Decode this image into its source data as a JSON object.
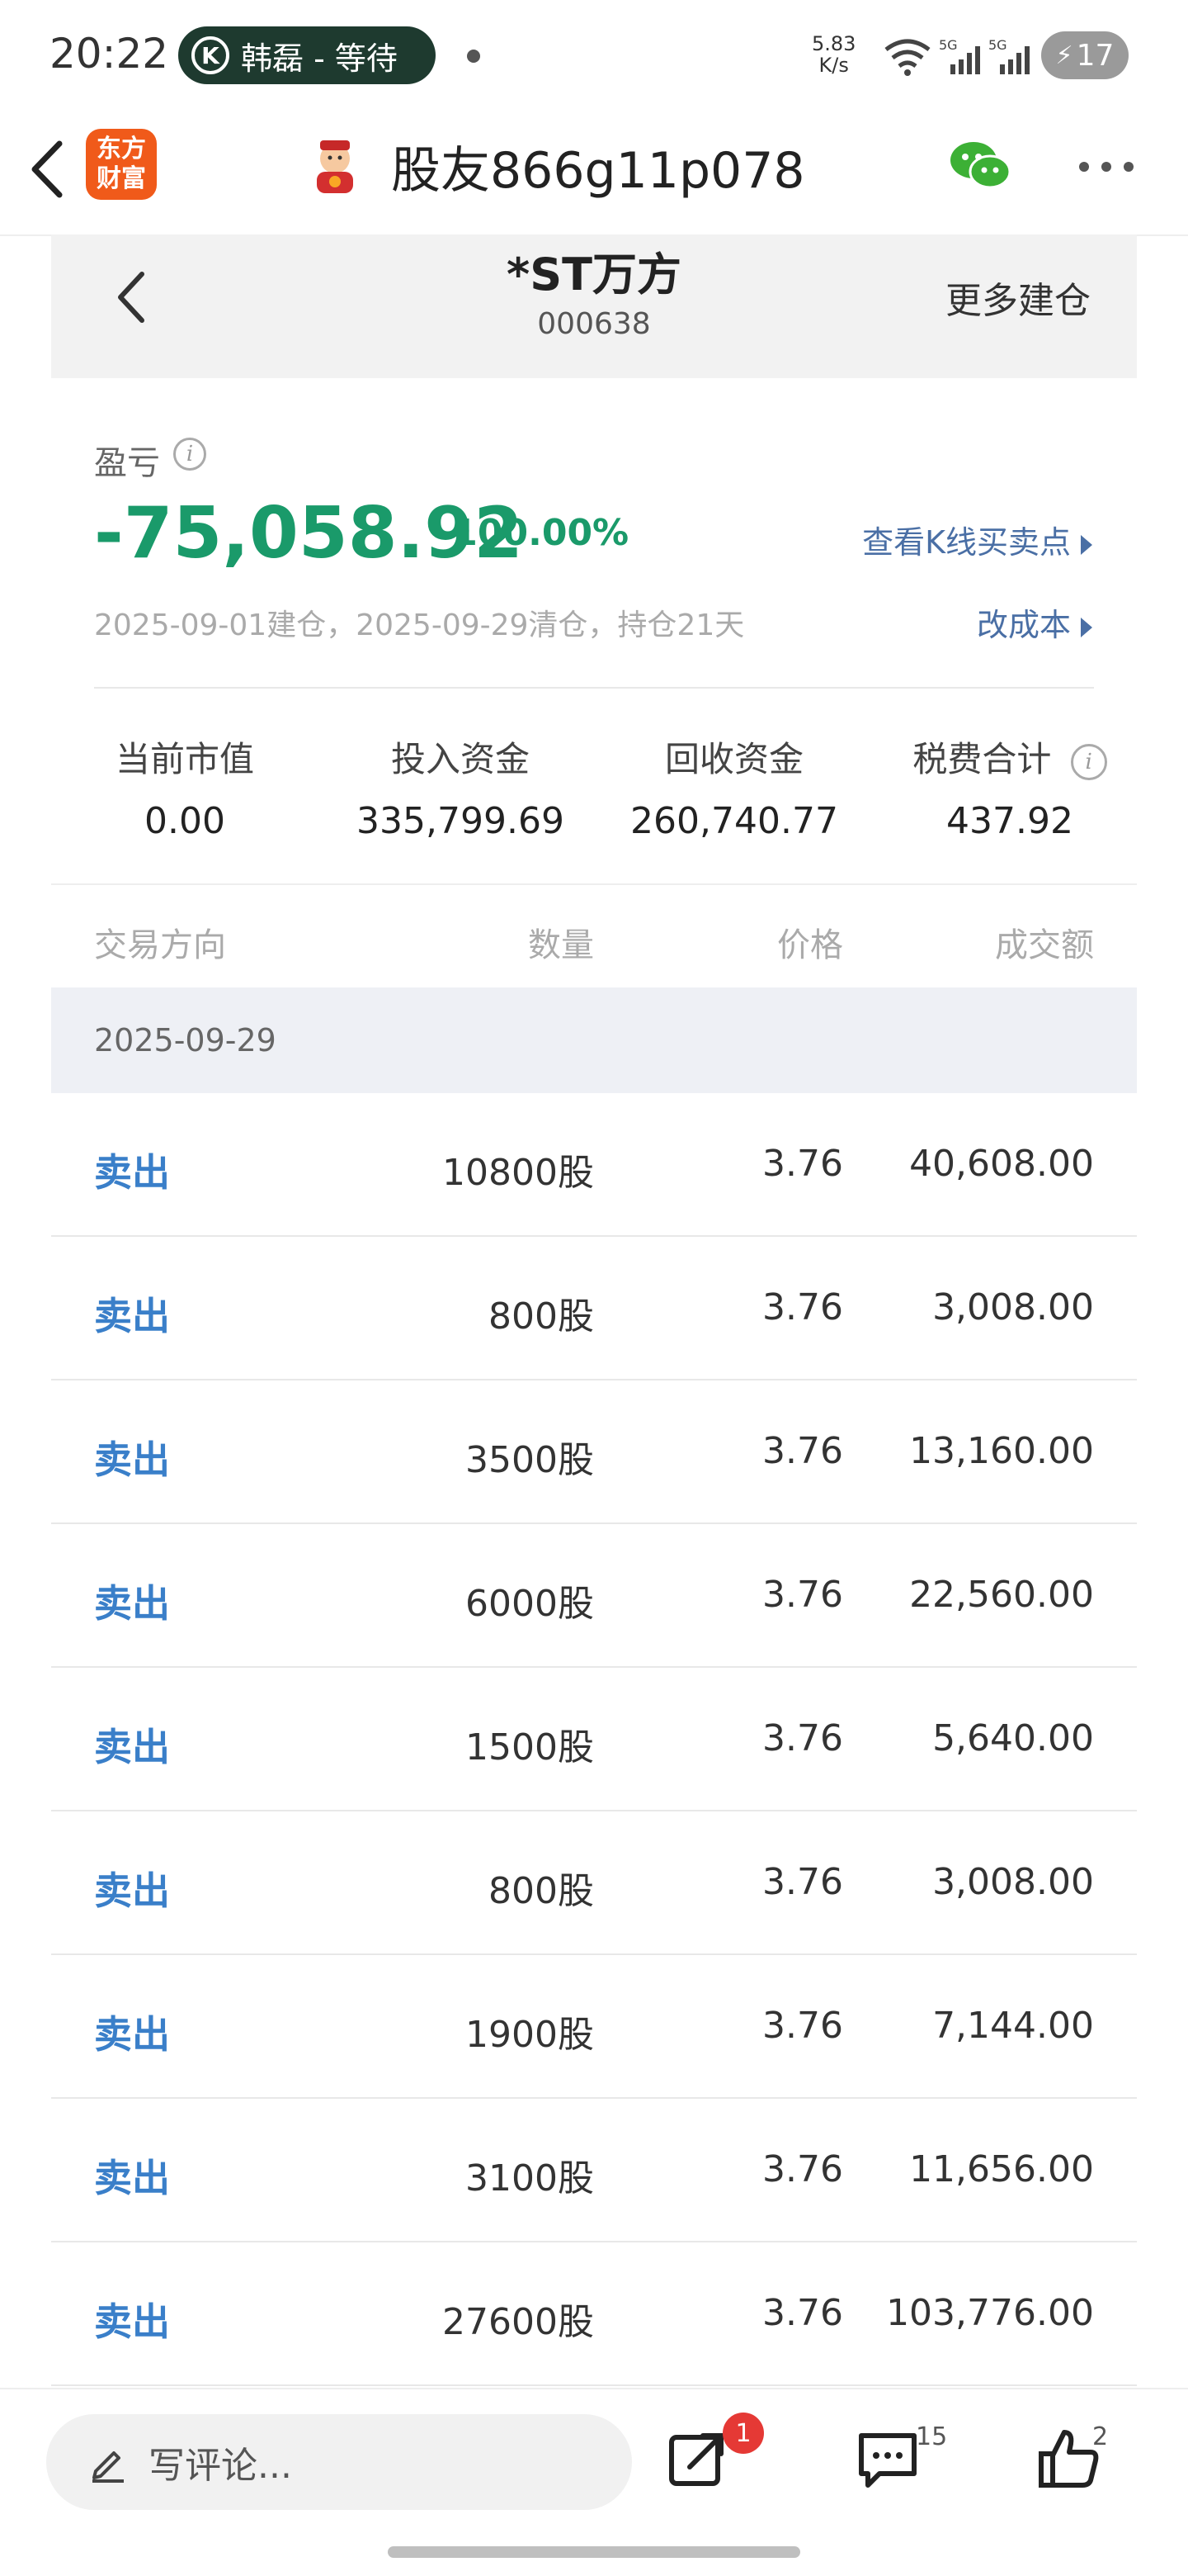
{
  "statusbar": {
    "time": "20:22",
    "pill_text": "韩磊 - 等待",
    "pill_icon": "K",
    "speed_value": "5.83",
    "speed_unit": "K/s",
    "battery": "17"
  },
  "nav": {
    "logo_text": "东方财富",
    "title": "股友866g11p078"
  },
  "stock": {
    "name": "*ST万方",
    "code": "000638",
    "more_action": "更多建仓"
  },
  "pl": {
    "label": "盈亏",
    "value": "-75,058.92",
    "percent": "-100.00%",
    "kline_link": "查看K线买卖点",
    "dates": "2025-09-01建仓，2025-09-29清仓，持仓21天",
    "cost_link": "改成本"
  },
  "stats": [
    {
      "label": "当前市值",
      "value": "0.00"
    },
    {
      "label": "投入资金",
      "value": "335,799.69"
    },
    {
      "label": "回收资金",
      "value": "260,740.77"
    },
    {
      "label": "税费合计",
      "value": "437.92"
    }
  ],
  "table": {
    "headers": {
      "direction": "交易方向",
      "quantity": "数量",
      "price": "价格",
      "amount": "成交额"
    },
    "date": "2025-09-29",
    "rows": [
      {
        "dir": "卖出",
        "qty": "10800股",
        "price": "3.76",
        "amount": "40,608.00"
      },
      {
        "dir": "卖出",
        "qty": "800股",
        "price": "3.76",
        "amount": "3,008.00"
      },
      {
        "dir": "卖出",
        "qty": "3500股",
        "price": "3.76",
        "amount": "13,160.00"
      },
      {
        "dir": "卖出",
        "qty": "6000股",
        "price": "3.76",
        "amount": "22,560.00"
      },
      {
        "dir": "卖出",
        "qty": "1500股",
        "price": "3.76",
        "amount": "5,640.00"
      },
      {
        "dir": "卖出",
        "qty": "800股",
        "price": "3.76",
        "amount": "3,008.00"
      },
      {
        "dir": "卖出",
        "qty": "1900股",
        "price": "3.76",
        "amount": "7,144.00"
      },
      {
        "dir": "卖出",
        "qty": "3100股",
        "price": "3.76",
        "amount": "11,656.00"
      },
      {
        "dir": "卖出",
        "qty": "27600股",
        "price": "3.76",
        "amount": "103,776.00"
      }
    ]
  },
  "bottom": {
    "comment_placeholder": "写评论...",
    "share_badge": "1",
    "comment_count": "15",
    "like_count": "2"
  },
  "colors": {
    "loss_green": "#1a9a6a",
    "link_blue": "#4a6fa5",
    "sell_blue": "#3a7fc9",
    "badge_red": "#e53935"
  }
}
